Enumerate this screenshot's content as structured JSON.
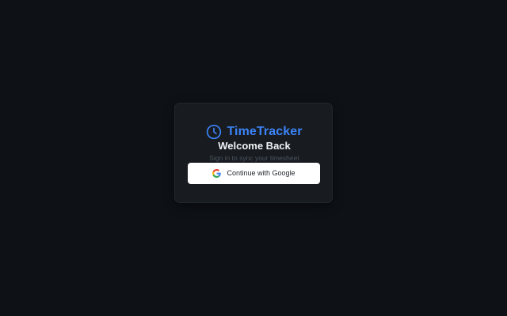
{
  "brand": {
    "name": "TimeTracker",
    "icon": "clock-icon",
    "accent_color": "#3b82f6"
  },
  "login": {
    "title": "Welcome Back",
    "subtitle": "Sign in to sync your timesheet",
    "google_button": {
      "label": "Continue with Google",
      "icon": "google-icon"
    }
  },
  "colors": {
    "background": "#0e1116",
    "card": "#181c21",
    "button": "#ffffff"
  }
}
